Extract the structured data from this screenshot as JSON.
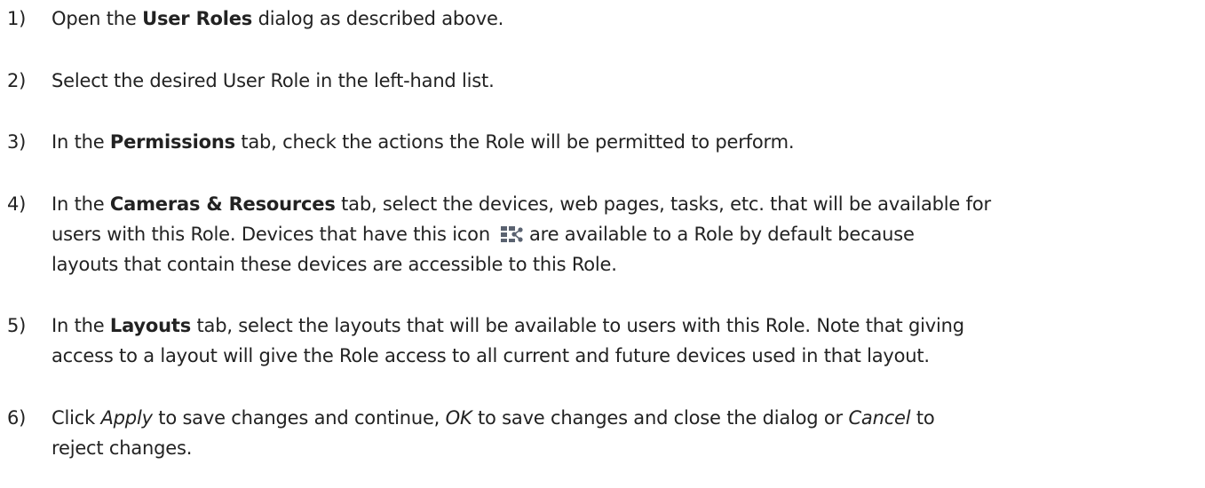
{
  "steps": [
    {
      "num": "1)",
      "pre": "Open the ",
      "bold": "User Roles",
      "post": " dialog as described above."
    },
    {
      "num": "2)",
      "text": "Select the desired User Role in the left-hand list."
    },
    {
      "num": "3)",
      "pre": "In the ",
      "bold": "Permissions",
      "post": " tab, check the actions the Role will be permitted to perform."
    },
    {
      "num": "4)",
      "pre": "In the ",
      "bold": "Cameras & Resources",
      "post": " tab, select the devices, web pages, tasks, etc. that will be available for",
      "line2_pre": "users with this Role. Devices that have this icon",
      "icon": "shared-layout-icon",
      "line2_post": "are available to a Role by default because",
      "line3": "layouts that contain these devices are accessible to this Role."
    },
    {
      "num": "5)",
      "pre": "In the ",
      "bold": "Layouts",
      "post": " tab, select the layouts that will be available to users with this Role. Note that giving",
      "line2": "access to a layout will give the Role access to all current and future devices used in that layout."
    },
    {
      "num": "6)",
      "pre": "Click ",
      "italic1": "Apply",
      "mid1": " to save changes and continue, ",
      "italic2": "OK",
      "mid2": " to save changes and close the dialog or ",
      "italic3": "Cancel",
      "post": " to",
      "line2": "reject changes."
    }
  ],
  "colors": {
    "text": "#222222",
    "icon": "#5a6270"
  }
}
